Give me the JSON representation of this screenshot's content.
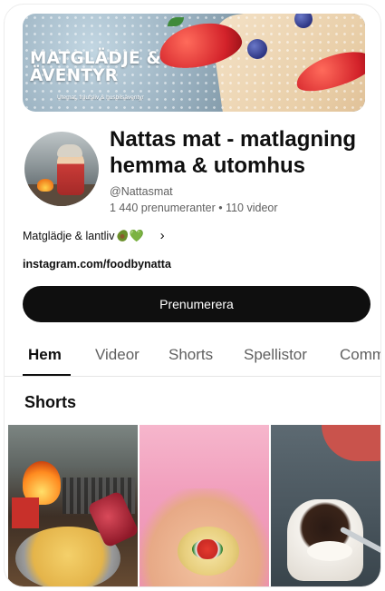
{
  "banner": {
    "title": "MATGLÄDJE &\nÄVENTYR",
    "subtitle": "Utemat, frilufsliv & husbilsäventyr"
  },
  "channel": {
    "name": "Nattas mat - matlagning hemma & utomhus",
    "handle": "@Nattasmat",
    "stats": "1 440 prenumeranter • 110 videor",
    "about": "Matglädje & lantliv",
    "about_chevron": "›",
    "link": "instagram.com/foodbynatta",
    "subscribe_label": "Prenumerera"
  },
  "tabs": [
    {
      "label": "Hem",
      "active": true
    },
    {
      "label": "Videor",
      "active": false
    },
    {
      "label": "Shorts",
      "active": false
    },
    {
      "label": "Spellistor",
      "active": false
    },
    {
      "label": "Comm",
      "active": false
    }
  ],
  "section": {
    "title": "Shorts"
  },
  "icons": {
    "about_emoji_1": "avocado-icon",
    "about_emoji_2": "green-heart-icon",
    "about_emoji_2_glyph": "💚",
    "chevron": "chevron-right-icon"
  },
  "colors": {
    "subscribe_bg": "#0f0f0f",
    "secondary_text": "#606060",
    "primary_text": "#0f0f0f"
  }
}
